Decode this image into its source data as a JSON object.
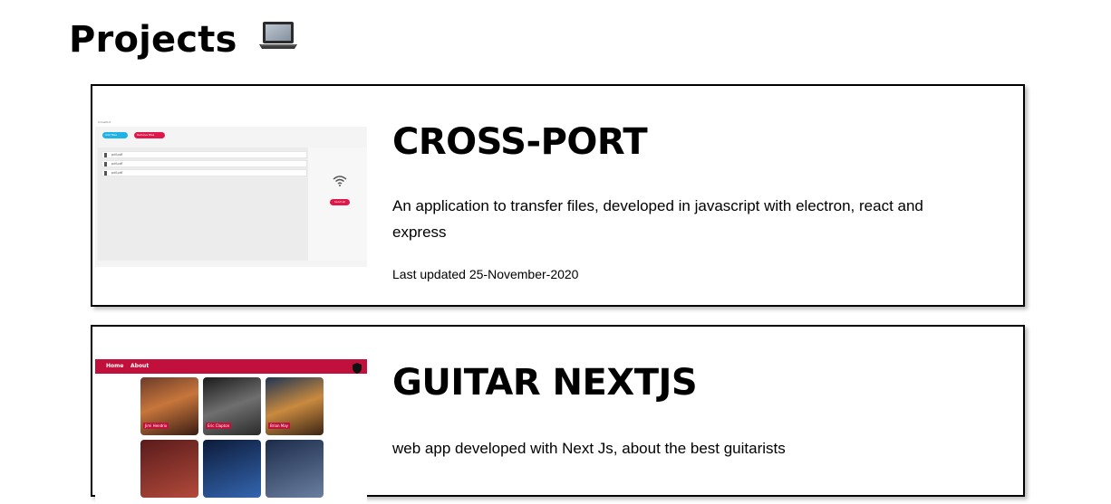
{
  "page": {
    "title": "Projects",
    "title_icon": "laptop-icon"
  },
  "projects": [
    {
      "title": "CROSS-PORT",
      "description": "An application to transfer files, developed in javascript with electron, react and express",
      "updated": "Last updated 25-November-2020",
      "thumbnail": {
        "window_title": "CrossPort",
        "buttons": [
          "Add files",
          "Remove files"
        ],
        "files": [
          "pdf.pdf",
          "pdf.pdf",
          "pdf.pdf"
        ],
        "send_label": "Send all",
        "icon": "wifi-icon",
        "accent_blue": "#1fb2e6",
        "accent_red": "#e0174b"
      }
    },
    {
      "title": "GUITAR NEXTJS",
      "description": "web app developed with Next Js, about the best guitarists",
      "thumbnail": {
        "nav": [
          "Home",
          "About"
        ],
        "nav_icon": "shield-icon",
        "guitarists": [
          "Jimi Hendrix",
          "Eric Clapton",
          "Brian May"
        ],
        "accent": "#c2103c"
      }
    }
  ]
}
